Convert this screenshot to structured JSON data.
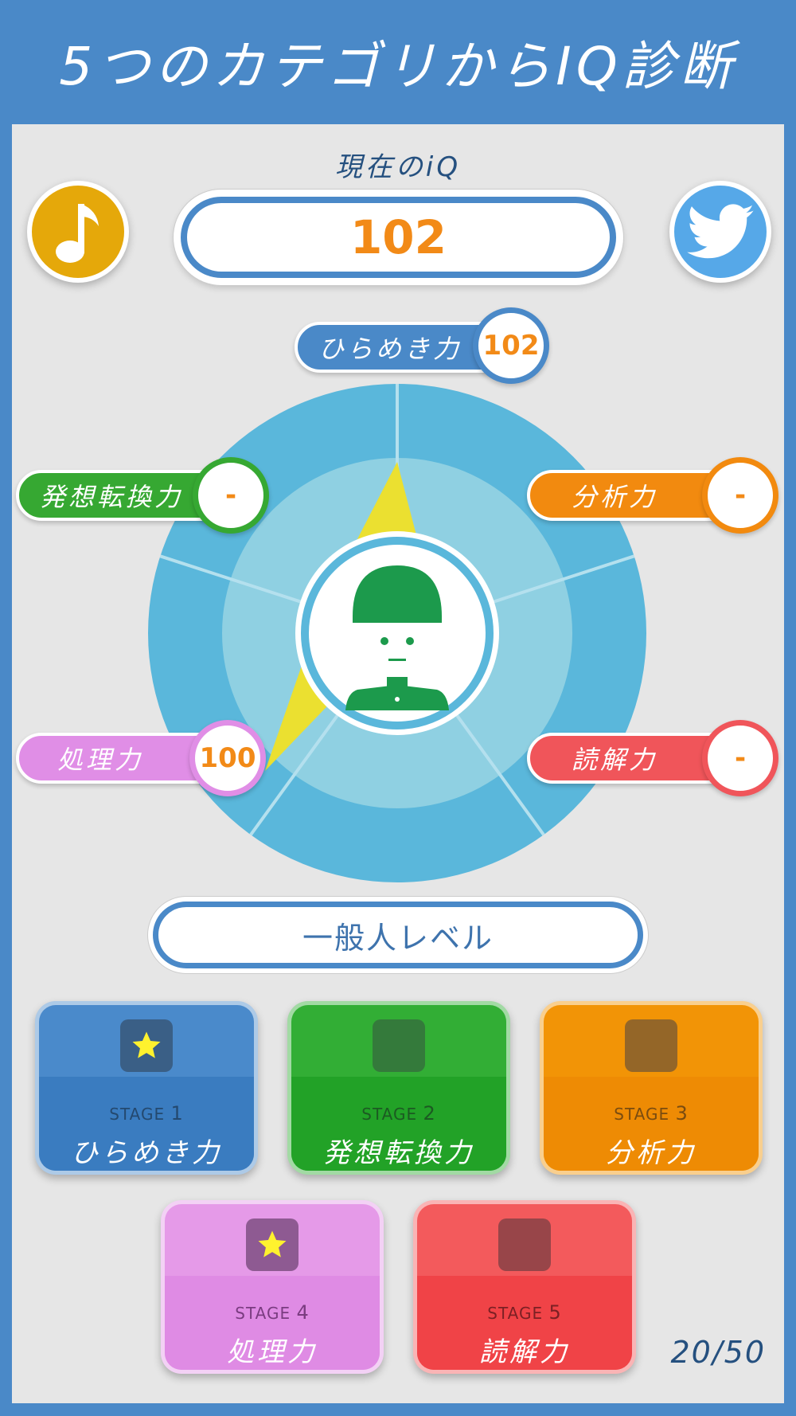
{
  "header": {
    "title": "5つのカテゴリからIQ診断"
  },
  "iq": {
    "label": "現在のiQ",
    "value": "102"
  },
  "buttons": {
    "music_icon": "music-note-icon",
    "twitter_icon": "twitter-bird-icon"
  },
  "categories": [
    {
      "name": "ひらめき力",
      "score": "102",
      "color": "#4a89c8"
    },
    {
      "name": "発想転換力",
      "score": "-",
      "color": "#36a832"
    },
    {
      "name": "分析力",
      "score": "-",
      "color": "#f28a0f"
    },
    {
      "name": "処理力",
      "score": "100",
      "color": "#e08ee6"
    },
    {
      "name": "読解力",
      "score": "-",
      "color": "#f0555a"
    }
  ],
  "level": {
    "text": "一般人レベル"
  },
  "stages": [
    {
      "prefix": "STAGE",
      "num": "1",
      "name": "ひらめき力",
      "cleared": true
    },
    {
      "prefix": "STAGE",
      "num": "2",
      "name": "発想転換力",
      "cleared": false
    },
    {
      "prefix": "STAGE",
      "num": "3",
      "name": "分析力",
      "cleared": false
    },
    {
      "prefix": "STAGE",
      "num": "4",
      "name": "処理力",
      "cleared": true
    },
    {
      "prefix": "STAGE",
      "num": "5",
      "name": "読解力",
      "cleared": false
    }
  ],
  "progress": {
    "text": "20/50"
  },
  "colors": {
    "header_blue": "#4a89c8",
    "score_orange": "#f28a17",
    "radar_outer": "#5ab7db",
    "radar_inner": "#8fd0e2",
    "radar_fill": "#ebe030"
  }
}
